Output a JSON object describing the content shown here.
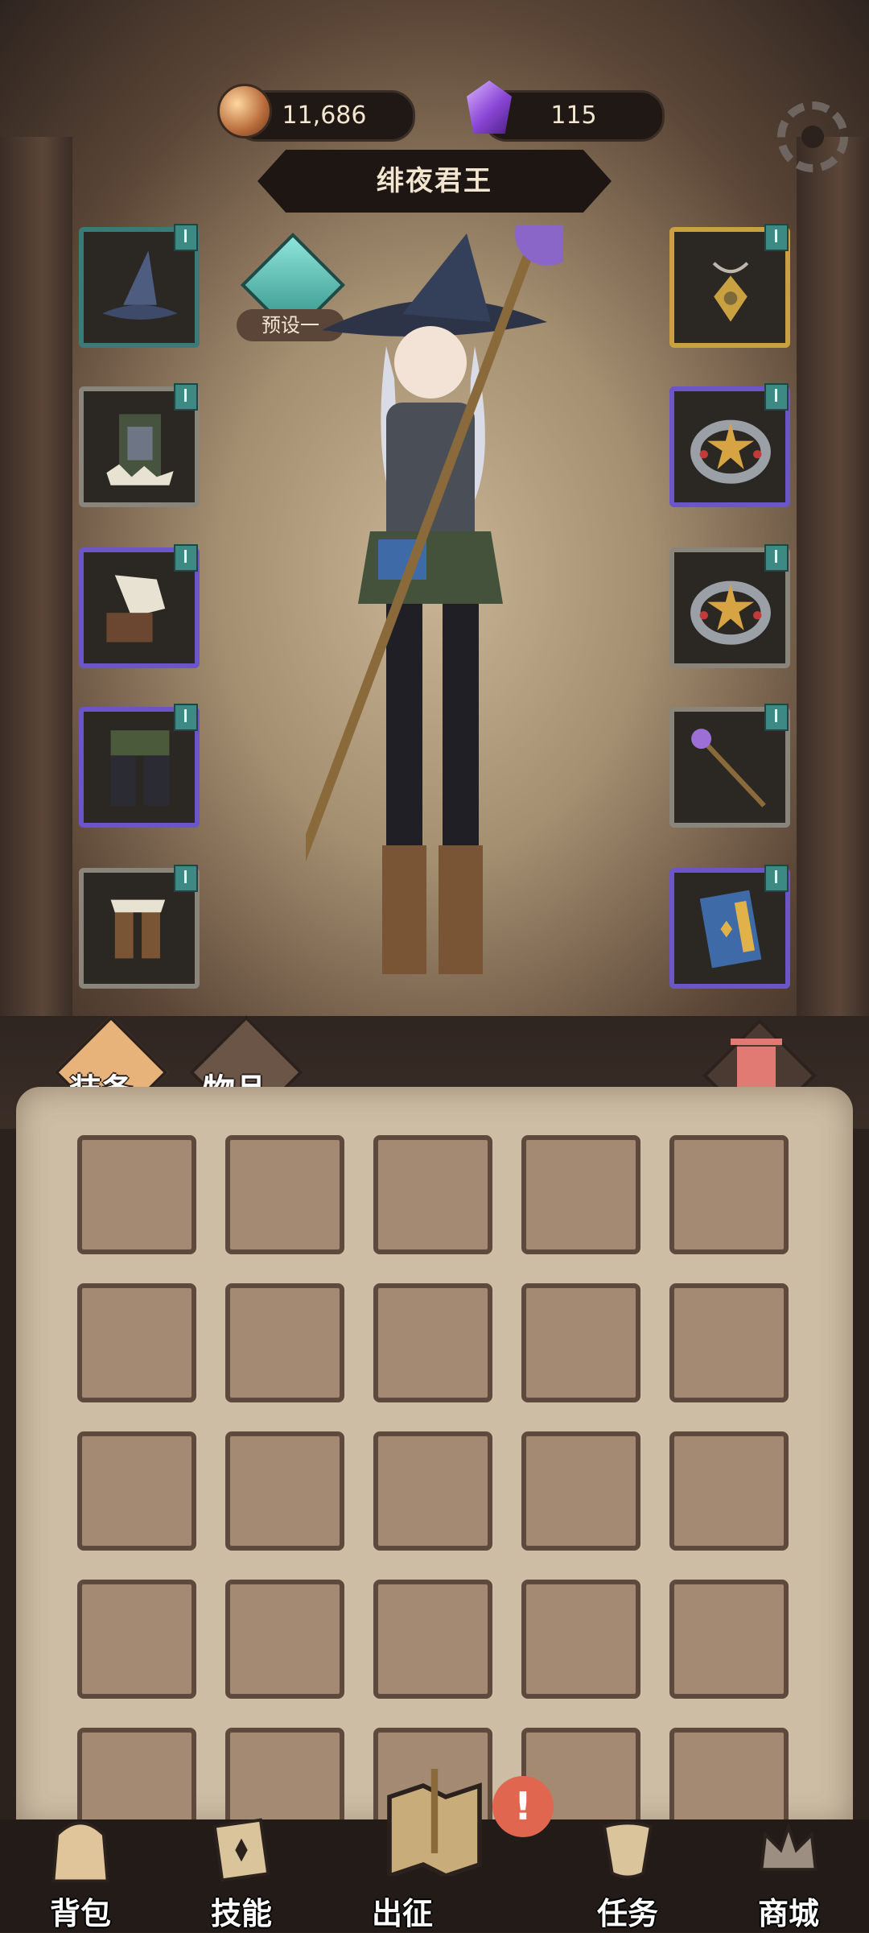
{
  "currency": {
    "gold_value": "11,686",
    "gem_value": "115"
  },
  "hero": {
    "name": "绯夜君王",
    "preset_label": "预设一"
  },
  "equipment_slots": {
    "left": [
      {
        "name": "witch-hat",
        "frame": "teal"
      },
      {
        "name": "robe",
        "frame": "grey"
      },
      {
        "name": "gloves",
        "frame": "purple"
      },
      {
        "name": "pants",
        "frame": "purple"
      },
      {
        "name": "boots",
        "frame": "grey"
      }
    ],
    "right": [
      {
        "name": "amulet",
        "frame": "gold"
      },
      {
        "name": "ring",
        "frame": "purple"
      },
      {
        "name": "ring",
        "frame": "grey"
      },
      {
        "name": "staff",
        "frame": "grey"
      },
      {
        "name": "spellbook",
        "frame": "purple"
      }
    ]
  },
  "inventory_tabs": {
    "equipment": "装备",
    "items": "物品"
  },
  "inventory": {
    "rows": 5,
    "columns": 5
  },
  "nav": {
    "backpack": "背包",
    "skills": "技能",
    "expedition": "出征",
    "tasks": "任务",
    "shop": "商城",
    "alert": "!"
  },
  "colors": {
    "teal_frame": "#3a7b79",
    "purple_frame": "#6b55c8",
    "gold_frame": "#c9a141",
    "panel": "#cdbda5"
  }
}
